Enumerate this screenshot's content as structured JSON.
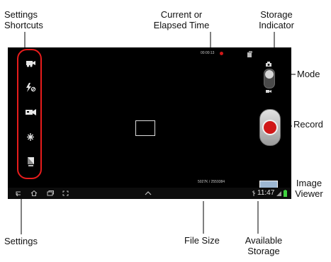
{
  "callouts": {
    "settings_shortcuts": [
      "Settings",
      "Shortcuts"
    ],
    "elapsed_time": [
      "Current or",
      "Elapsed Time"
    ],
    "storage_indicator": [
      "Storage",
      "Indicator"
    ],
    "mode": "Mode",
    "record": "Record",
    "image_viewer": [
      "Image",
      "Viewer"
    ],
    "settings": "Settings",
    "file_size": "File Size",
    "available_storage": [
      "Available",
      "Storage"
    ]
  },
  "camera": {
    "timer": "00:00:13",
    "file_size_readout": "5027K / 2559384",
    "clock": "11:47"
  },
  "colors": {
    "callout_ring": "#e81c1c",
    "record_dot": "#d01818",
    "screen_bg": "#000000",
    "battery": "#3fd23f"
  },
  "icons": {
    "shortcuts": [
      "camcorder-switch-icon",
      "flash-off-icon",
      "recording-mode-icon",
      "exposure-icon",
      "storage-card-icon"
    ],
    "settings": "gear-icon",
    "mode_switch": [
      "camera-icon",
      "video-icon"
    ],
    "navigation": [
      "back-icon",
      "home-icon",
      "recent-apps-icon",
      "screenshot-icon",
      "up-chevron-icon"
    ]
  }
}
